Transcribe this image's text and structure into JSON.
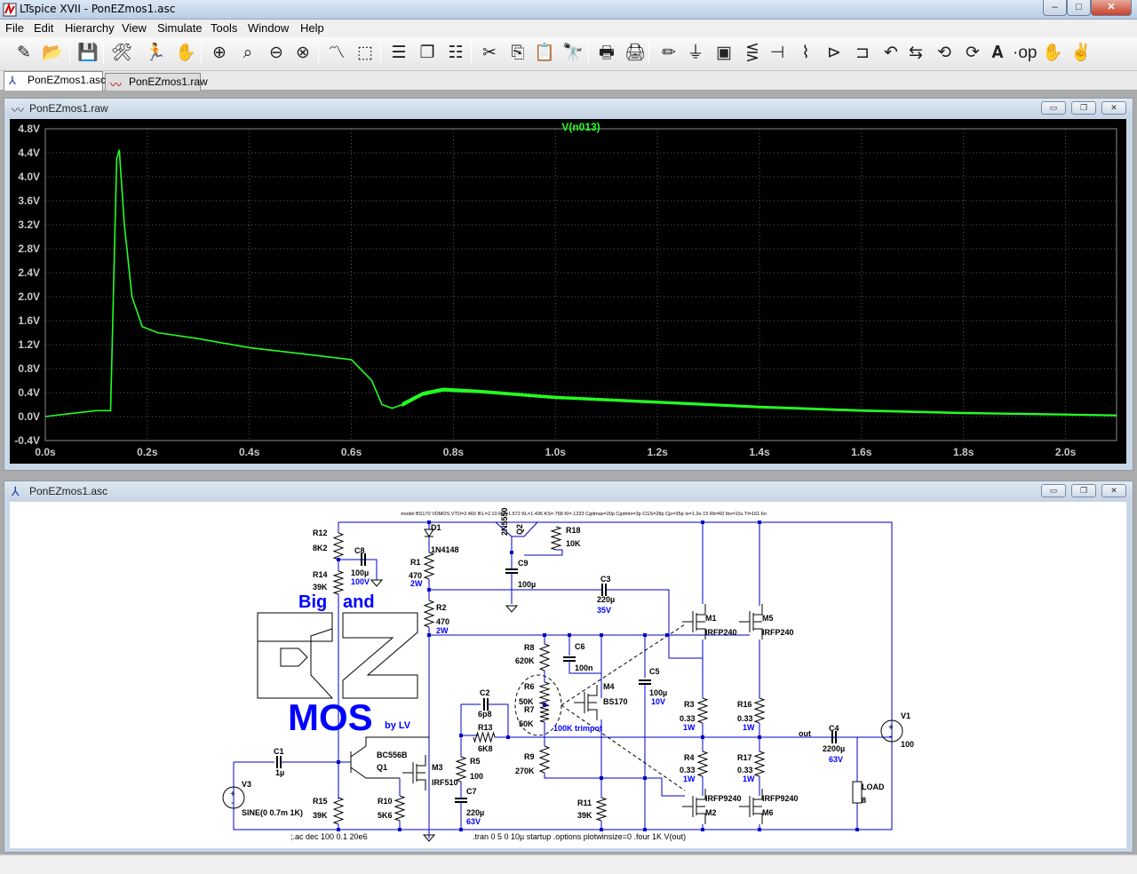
{
  "window": {
    "title": "LTspice XVII - PonEZmos1.asc",
    "min_glyph": "–",
    "max_glyph": "□",
    "close_glyph": "✕"
  },
  "menu": [
    "File",
    "Edit",
    "Hierarchy",
    "View",
    "Simulate",
    "Tools",
    "Window",
    "Help"
  ],
  "toolbar_icons": [
    "new-schematic-icon",
    "open-icon",
    "save-icon",
    "control-panel-icon",
    "run-icon",
    "halt-icon",
    "zoom-in-icon",
    "pan-icon",
    "zoom-out-icon",
    "zoom-cancel-icon",
    "autorange-icon",
    "mark-unref-icon",
    "tile-horizontal-icon",
    "cascade-icon",
    "tile-vertical-icon",
    "cut-icon",
    "copy-icon",
    "paste-icon",
    "find-icon",
    "print-icon",
    "print-setup-icon",
    "draw-wire-icon",
    "ground-icon",
    "label-net-icon",
    "resistor-icon",
    "capacitor-icon",
    "inductor-icon",
    "diode-icon",
    "component-icon",
    "rotate-icon",
    "mirror-icon",
    "undo-icon",
    "redo-icon",
    "text-icon",
    "spice-directive-icon",
    "hand-move-icon",
    "hand-drag-icon"
  ],
  "tabs": [
    {
      "label": "PonEZmos1.asc",
      "icon": "schematic-icon",
      "active": true
    },
    {
      "label": "PonEZmos1.raw",
      "icon": "waveform-icon",
      "active": false
    }
  ],
  "plot_window": {
    "title": "PonEZmos1.raw",
    "btns": [
      "▭",
      "❐",
      "✕"
    ]
  },
  "schematic_window": {
    "title": "PonEZmos1.asc",
    "btns": [
      "▭",
      "❐",
      "✕"
    ]
  },
  "colors": {
    "trace": "#22ff22",
    "plot_bg": "#000000",
    "grid": "#5a5a5a",
    "tick_text": "#c8c8c8",
    "wire": "#0000c8",
    "label_blue": "#0000ff",
    "comp": "#000000"
  },
  "chart_data": {
    "type": "line",
    "title": "V(n013)",
    "xlabel": "",
    "ylabel": "",
    "xlim": [
      0.0,
      2.1
    ],
    "ylim": [
      -0.4,
      4.8
    ],
    "x_ticks": [
      "0.0s",
      "0.2s",
      "0.4s",
      "0.6s",
      "0.8s",
      "1.0s",
      "1.2s",
      "1.4s",
      "1.6s",
      "1.8s",
      "2.0s"
    ],
    "x_tick_values": [
      0,
      0.2,
      0.4,
      0.6,
      0.8,
      1.0,
      1.2,
      1.4,
      1.6,
      1.8,
      2.0
    ],
    "y_ticks": [
      "4.8V",
      "4.4V",
      "4.0V",
      "3.6V",
      "3.2V",
      "2.8V",
      "2.4V",
      "2.0V",
      "1.6V",
      "1.2V",
      "0.8V",
      "0.4V",
      "0.0V",
      "-0.4V"
    ],
    "y_tick_values": [
      4.8,
      4.4,
      4.0,
      3.6,
      3.2,
      2.8,
      2.4,
      2.0,
      1.6,
      1.2,
      0.8,
      0.4,
      0.0,
      -0.4
    ],
    "grid": true,
    "series": [
      {
        "name": "V(n013)",
        "x": [
          0.0,
          0.05,
          0.1,
          0.128,
          0.132,
          0.14,
          0.145,
          0.155,
          0.17,
          0.19,
          0.22,
          0.3,
          0.4,
          0.5,
          0.6,
          0.64,
          0.66,
          0.68,
          0.7,
          0.74,
          0.78,
          0.85,
          1.0,
          1.2,
          1.4,
          1.6,
          1.8,
          2.1
        ],
        "y": [
          0.0,
          0.05,
          0.1,
          0.1,
          1.5,
          4.3,
          4.45,
          3.2,
          2.0,
          1.5,
          1.4,
          1.3,
          1.15,
          1.05,
          0.95,
          0.6,
          0.2,
          0.14,
          0.2,
          0.38,
          0.45,
          0.42,
          0.32,
          0.24,
          0.16,
          0.1,
          0.06,
          0.02
        ],
        "ripple_start": 0.7,
        "ripple_pp": [
          0.06,
          0.02
        ]
      }
    ]
  },
  "schematic": {
    "directive_top": ".model BS170 VDMOS VTO=2.460 IKL=2.10 RS=1.572 KL=1.436 KS=.768 KI=.1233 Cgdmax=20p Cgdmin=3p CGS=28p Cjo=35p Is=1.2e-15 Rb=60 Ibv=10u Tt=161.6n",
    "directive_ac": ";.ac dec 100 0.1 20e6",
    "directive_tran": ".tran 0 5 0 10µ startup  .options plotwinsize=0 .four 1K V(out)",
    "logo": {
      "line1a": "Big",
      "line1b": "and",
      "line2": "MOS",
      "line3": "by LV"
    },
    "labels": [
      {
        "n": "r12-name",
        "t": "R12"
      },
      {
        "n": "r12-value",
        "t": "8K2"
      },
      {
        "n": "r14-name",
        "t": "R14"
      },
      {
        "n": "r14-value",
        "t": "39K"
      },
      {
        "n": "c8-name",
        "t": "C8"
      },
      {
        "n": "c8-value",
        "t": "100µ"
      },
      {
        "n": "c8-rating",
        "t": "100V"
      },
      {
        "n": "d1-name",
        "t": "D1"
      },
      {
        "n": "d1-value",
        "t": "1N4148"
      },
      {
        "n": "r1-name",
        "t": "R1"
      },
      {
        "n": "r1-value",
        "t": "470"
      },
      {
        "n": "r1-rating",
        "t": "2W"
      },
      {
        "n": "r2-name",
        "t": "R2"
      },
      {
        "n": "r2-value",
        "t": "470"
      },
      {
        "n": "r2-rating",
        "t": "2W"
      },
      {
        "n": "q2-name",
        "t": "Q2"
      },
      {
        "n": "q2-value",
        "t": "2N5550"
      },
      {
        "n": "r18-name",
        "t": "R18"
      },
      {
        "n": "r18-value",
        "t": "10K"
      },
      {
        "n": "c9-name",
        "t": "C9"
      },
      {
        "n": "c9-value",
        "t": "100µ"
      },
      {
        "n": "c3-name",
        "t": "C3"
      },
      {
        "n": "c3-value",
        "t": "220µ"
      },
      {
        "n": "c3-rating",
        "t": "35V"
      },
      {
        "n": "m1-name",
        "t": "M1"
      },
      {
        "n": "m1-value",
        "t": "IRFP240"
      },
      {
        "n": "m5-name",
        "t": "M5"
      },
      {
        "n": "m5-value",
        "t": "IRFP240"
      },
      {
        "n": "r8-name",
        "t": "R8"
      },
      {
        "n": "r8-value",
        "t": "620K"
      },
      {
        "n": "c6-name",
        "t": "C6"
      },
      {
        "n": "c6-value",
        "t": "100n"
      },
      {
        "n": "c5-name",
        "t": "C5"
      },
      {
        "n": "c5-value",
        "t": "100µ"
      },
      {
        "n": "c5-rating",
        "t": "10V"
      },
      {
        "n": "m4-name",
        "t": "M4"
      },
      {
        "n": "m4-value",
        "t": "BS170"
      },
      {
        "n": "r6-name",
        "t": "R6"
      },
      {
        "n": "r6-value",
        "t": "50K"
      },
      {
        "n": "r7-name",
        "t": "R7"
      },
      {
        "n": "r7-value",
        "t": "50K"
      },
      {
        "n": "trimpot-label",
        "t": "100K trimpot"
      },
      {
        "n": "c2-name",
        "t": "C2"
      },
      {
        "n": "c2-value",
        "t": "6p8"
      },
      {
        "n": "r13-name",
        "t": "R13"
      },
      {
        "n": "r13-value",
        "t": "6K8"
      },
      {
        "n": "r3-name",
        "t": "R3"
      },
      {
        "n": "r3-value",
        "t": "0.33"
      },
      {
        "n": "r3-rating",
        "t": "1W"
      },
      {
        "n": "r16-name",
        "t": "R16"
      },
      {
        "n": "r16-value",
        "t": "0.33"
      },
      {
        "n": "r16-rating",
        "t": "1W"
      },
      {
        "n": "out-label",
        "t": "out"
      },
      {
        "n": "c4-name",
        "t": "C4"
      },
      {
        "n": "c4-value",
        "t": "2200µ"
      },
      {
        "n": "c4-rating",
        "t": "63V"
      },
      {
        "n": "v1-name",
        "t": "V1"
      },
      {
        "n": "v1-value",
        "t": "100"
      },
      {
        "n": "c1-name",
        "t": "C1"
      },
      {
        "n": "c1-value",
        "t": "1µ"
      },
      {
        "n": "q1-value",
        "t": "BC556B"
      },
      {
        "n": "q1-name",
        "t": "Q1"
      },
      {
        "n": "m3-name",
        "t": "M3"
      },
      {
        "n": "m3-value",
        "t": "IRF510"
      },
      {
        "n": "r5-name",
        "t": "R5"
      },
      {
        "n": "r5-value",
        "t": "100"
      },
      {
        "n": "r9-name",
        "t": "R9"
      },
      {
        "n": "r9-value",
        "t": "270K"
      },
      {
        "n": "r4-name",
        "t": "R4"
      },
      {
        "n": "r4-value",
        "t": "0.33"
      },
      {
        "n": "r4-rating",
        "t": "1W"
      },
      {
        "n": "r17-name",
        "t": "R17"
      },
      {
        "n": "r17-value",
        "t": "0.33"
      },
      {
        "n": "r17-rating",
        "t": "1W"
      },
      {
        "n": "v3-name",
        "t": "V3"
      },
      {
        "n": "v3-value",
        "t": "SINE(0 0.7m 1K)"
      },
      {
        "n": "r15-name",
        "t": "R15"
      },
      {
        "n": "r15-value",
        "t": "39K"
      },
      {
        "n": "r10-name",
        "t": "R10"
      },
      {
        "n": "r10-value",
        "t": "5K6"
      },
      {
        "n": "c7-name",
        "t": "C7"
      },
      {
        "n": "c7-value",
        "t": "220µ"
      },
      {
        "n": "c7-rating",
        "t": "63V"
      },
      {
        "n": "m2-name",
        "t": "M2"
      },
      {
        "n": "m2-value",
        "t": "IRFP9240"
      },
      {
        "n": "m6-name",
        "t": "M6"
      },
      {
        "n": "m6-value",
        "t": "IRFP9240"
      },
      {
        "n": "r11-name",
        "t": "R11"
      },
      {
        "n": "r11-value",
        "t": "39K"
      },
      {
        "n": "load-name",
        "t": "LOAD"
      },
      {
        "n": "load-value",
        "t": "8"
      }
    ]
  }
}
